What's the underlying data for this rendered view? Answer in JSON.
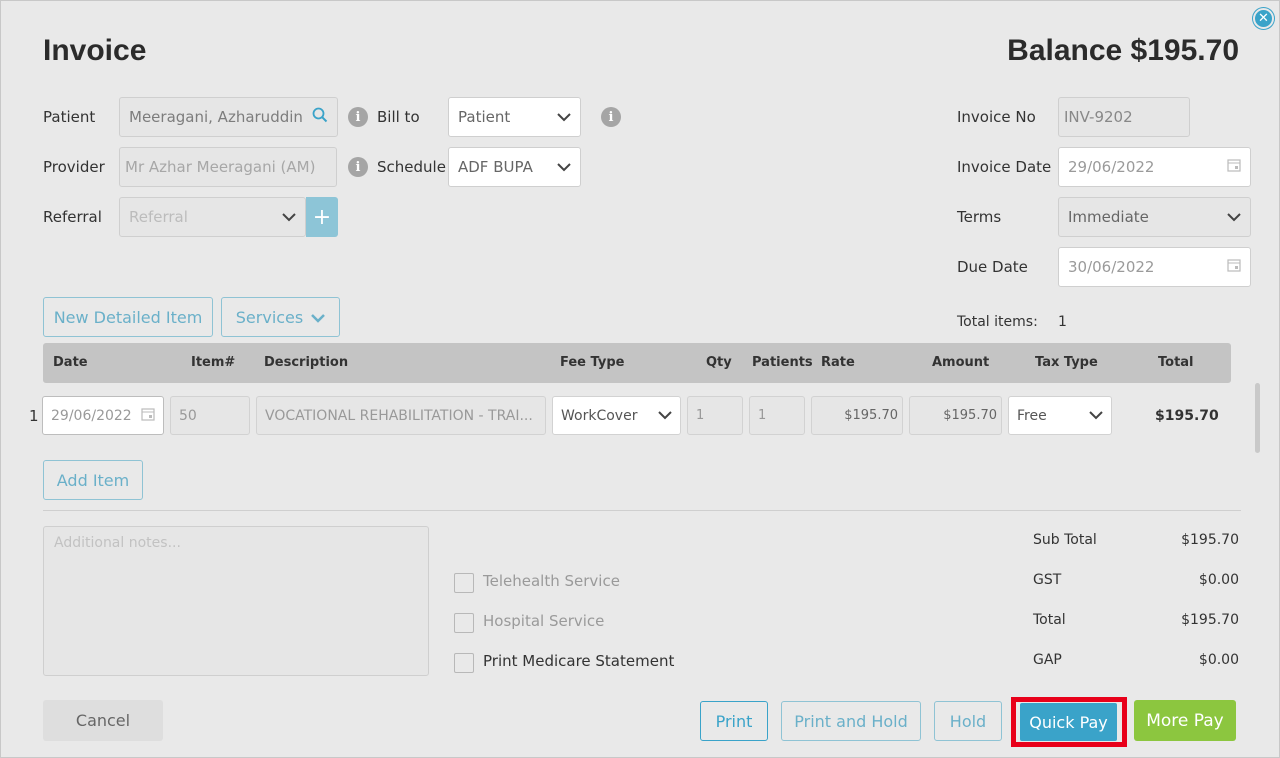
{
  "header": {
    "title": "Invoice",
    "balance": "Balance $195.70"
  },
  "form": {
    "patient_label": "Patient",
    "patient_value": "Meeragani, Azharuddin",
    "provider_label": "Provider",
    "provider_value": "Mr Azhar Meeragani (AM)",
    "referral_label": "Referral",
    "referral_placeholder": "Referral",
    "bill_to_label": "Bill to",
    "bill_to_value": "Patient",
    "schedule_label": "Schedule",
    "schedule_value": "ADF BUPA",
    "invoice_no_label": "Invoice No",
    "invoice_no_value": "INV-9202",
    "invoice_date_label": "Invoice Date",
    "invoice_date_value": "29/06/2022",
    "terms_label": "Terms",
    "terms_value": "Immediate",
    "due_date_label": "Due Date",
    "due_date_value": "30/06/2022",
    "total_items_label": "Total items:",
    "total_items_value": "1"
  },
  "toolbar": {
    "new_detailed_item": "New Detailed Item",
    "services": "Services",
    "add_item": "Add Item"
  },
  "table": {
    "headers": [
      "Date",
      "Item#",
      "Description",
      "Fee Type",
      "Qty",
      "Patients",
      "Rate",
      "Amount",
      "Tax Type",
      "Total"
    ],
    "rows": [
      {
        "index": "1",
        "date": "29/06/2022",
        "item": "50",
        "description": "VOCATIONAL REHABILITATION - TRAI...",
        "fee_type": "WorkCover",
        "qty": "1",
        "patients": "1",
        "rate": "$195.70",
        "amount": "$195.70",
        "tax_type": "Free",
        "total": "$195.70"
      }
    ]
  },
  "notes": {
    "placeholder": "Additional notes..."
  },
  "options": {
    "telehealth": "Telehealth Service",
    "hospital": "Hospital Service",
    "medicare": "Print Medicare Statement"
  },
  "summary": {
    "sub_total_label": "Sub Total",
    "sub_total": "$195.70",
    "gst_label": "GST",
    "gst": "$0.00",
    "total_label": "Total",
    "total": "$195.70",
    "gap_label": "GAP",
    "gap": "$0.00"
  },
  "footer": {
    "cancel": "Cancel",
    "print": "Print",
    "print_and_hold": "Print and Hold",
    "hold": "Hold",
    "quick_pay": "Quick Pay",
    "more_pay": "More Pay"
  },
  "colors": {
    "accent": "#3aa3c9",
    "more_pay": "#8cc63f",
    "highlight": "#e8001a"
  }
}
